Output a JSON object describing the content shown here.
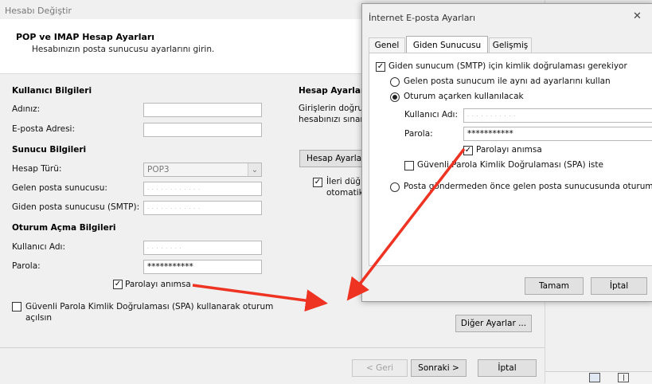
{
  "main_window": {
    "title": "Hesabı Değiştir",
    "header": {
      "title": "POP ve IMAP Hesap Ayarları",
      "subtitle": "Hesabınızın posta sunucusu ayarlarını girin."
    },
    "user_info": {
      "heading": "Kullanıcı Bilgileri",
      "name_label": "Adınız:",
      "name_value": "",
      "email_label": "E-posta Adresi:",
      "email_value": ""
    },
    "server_info": {
      "heading": "Sunucu Bilgileri",
      "account_type_label": "Hesap Türü:",
      "account_type_value": "POP3",
      "incoming_label": "Gelen posta sunucusu:",
      "outgoing_label": "Giden posta sunucusu (SMTP):"
    },
    "login_info": {
      "heading": "Oturum Açma Bilgileri",
      "username_label": "Kullanıcı Adı:",
      "password_label": "Parola:",
      "password_value": "***********",
      "remember_label": "Parolayı anımsa",
      "remember_checked": true
    },
    "spa_label_line1": "Güvenli Parola Kimlik Doğrulaması (SPA) kullanarak oturum",
    "spa_label_line2": "açılsın",
    "spa_checked": false,
    "right_panel": {
      "heading": "Hesap Ayarları",
      "desc_line1": "Girişlerin doğru",
      "desc_line2": "hesabınızı sınar",
      "test_button": "Hesap Ayarlar",
      "next_check_line1": "İleri düğ",
      "next_check_line2": "otomatik",
      "next_check_checked": true
    },
    "more_settings_button": "Diğer Ayarlar ...",
    "back_button": "< Geri",
    "next_button": "Sonraki >",
    "cancel_button": "İptal"
  },
  "dialog": {
    "title": "İnternet E-posta Ayarları",
    "close_glyph": "✕",
    "tabs": [
      "Genel",
      "Giden Sunucusu",
      "Gelişmiş"
    ],
    "active_tab": "Giden Sunucusu",
    "smtp_auth_label": "Giden sunucum (SMTP) için kimlik doğrulaması gerekiyor",
    "smtp_auth_checked": true,
    "radio_same": "Gelen posta sunucum ile aynı ad ayarlarını kullan",
    "radio_login": "Oturum açarken kullanılacak",
    "username_label": "Kullanıcı Adı:",
    "password_label": "Parola:",
    "password_value": "***********",
    "remember_label": "Parolayı anımsa",
    "remember_checked": true,
    "spa_label": "Güvenli Parola Kimlik Doğrulaması (SPA) iste",
    "spa_checked": false,
    "radio_pop_first": "Posta göndermeden önce gelen posta sunucusunda oturum",
    "ok_button": "Tamam",
    "cancel_button": "İptal"
  },
  "check_glyph": "✓",
  "dropdown_glyph": "⌄",
  "colors": {
    "arrow": "#ee3322",
    "window_bg": "#f0f0f0"
  }
}
